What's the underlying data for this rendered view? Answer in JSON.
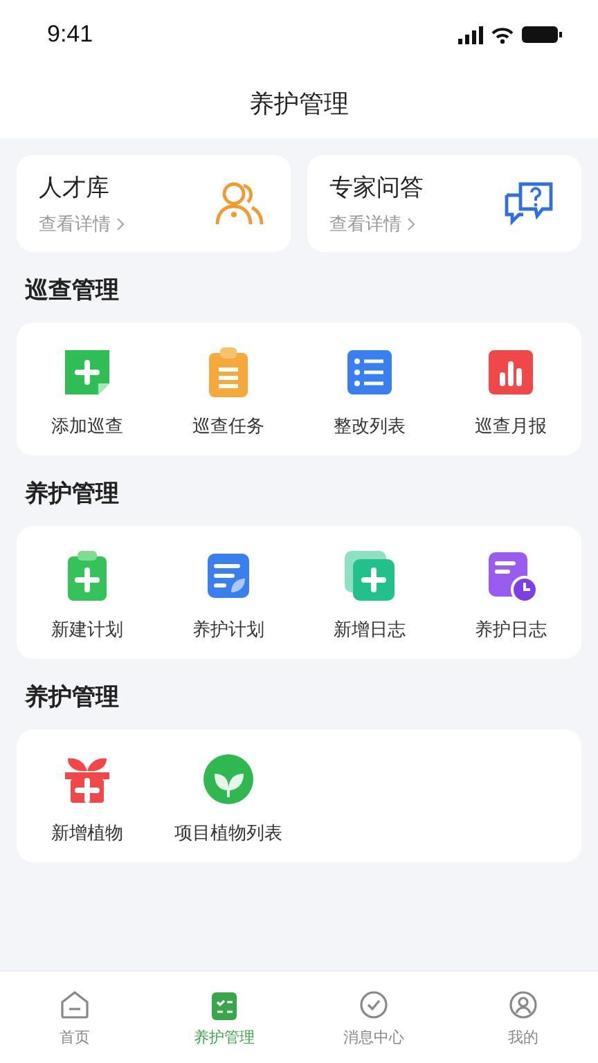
{
  "status_bar": {
    "time": "9:41"
  },
  "header": {
    "title": "养护管理"
  },
  "shortcuts": [
    {
      "title": "人才库",
      "link": "查看详情"
    },
    {
      "title": "专家问答",
      "link": "查看详情"
    }
  ],
  "sections": [
    {
      "title": "巡查管理",
      "items": [
        "添加巡查",
        "巡查任务",
        "整改列表",
        "巡查月报"
      ]
    },
    {
      "title": "养护管理",
      "items": [
        "新建计划",
        "养护计划",
        "新增日志",
        "养护日志"
      ]
    },
    {
      "title": "养护管理",
      "items": [
        "新增植物",
        "项目植物列表"
      ]
    }
  ],
  "tab_bar": [
    {
      "label": "首页",
      "selected": false
    },
    {
      "label": "养护管理",
      "selected": true
    },
    {
      "label": "消息中心",
      "selected": false
    },
    {
      "label": "我的",
      "selected": false
    }
  ]
}
